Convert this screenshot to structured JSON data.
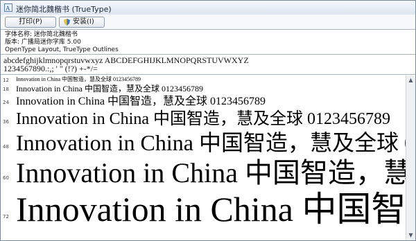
{
  "window": {
    "title": "迷你简北魏楷书 (TrueType)"
  },
  "toolbar": {
    "print_label": "打印(P)",
    "install_label": "安装(I)"
  },
  "info": {
    "name": "字体名称: 迷你简北魏楷书",
    "version": "版本: 广播局迷你字库 5.00",
    "type": "OpenType Layout, TrueType Outlines"
  },
  "charset": {
    "line1": "abcdefghijklmnopqrstuvwxyz ABCDEFGHIJKLMNOPQRSTUVWXYZ",
    "line2": "1234567890.:,; ' \" (!?) +-*/="
  },
  "samples": {
    "latin": "Innovation in China ",
    "cjk": "中国智造，慧及全球",
    "digits": " 0123456789",
    "rows": [
      {
        "size": "12"
      },
      {
        "size": "18"
      },
      {
        "size": "24"
      },
      {
        "size": "36"
      },
      {
        "size": "48"
      },
      {
        "size": "60"
      },
      {
        "size": "72"
      }
    ]
  },
  "scrollbar": {
    "up_icon": "▲",
    "down_icon": "▼"
  }
}
